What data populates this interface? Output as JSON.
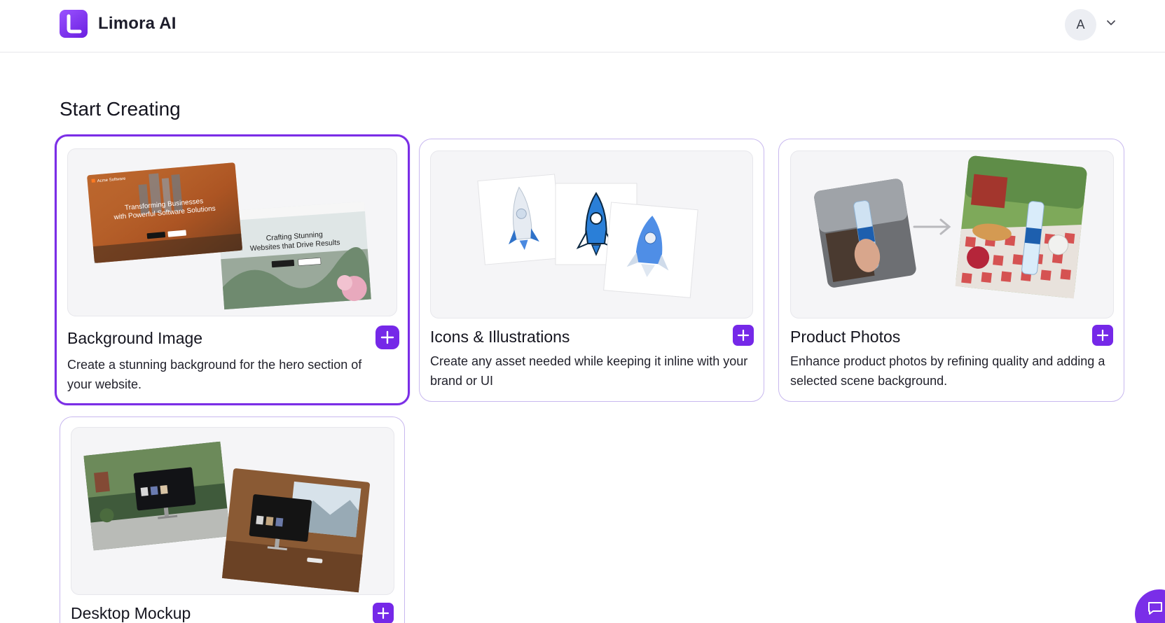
{
  "header": {
    "brand": "Limora AI",
    "avatar_initial": "A"
  },
  "page": {
    "title": "Start Creating"
  },
  "cards": [
    {
      "title": "Background Image",
      "description": "Create a stunning background for the hero section of your website.",
      "selected": true,
      "thumb_text": {
        "site_name": "Acme Software",
        "hero1": "Transforming Businesses with Powerful Software Solutions",
        "hero2": "Crafting Stunning Websites that Drive Results"
      }
    },
    {
      "title": "Icons & Illustrations",
      "description": "Create any asset needed while keeping it inline with your brand or UI",
      "selected": false
    },
    {
      "title": "Product Photos",
      "description": "Enhance product photos by refining quality and adding a selected scene background.",
      "selected": false
    },
    {
      "title": "Desktop Mockup",
      "description": "",
      "selected": false
    }
  ],
  "colors": {
    "accent": "#7528e8",
    "card_border": "#c8b8ef",
    "selected_border": "#7b2ee6"
  },
  "icons": {
    "logo": "limora-logo-icon",
    "chevron": "chevron-down-icon",
    "add": "plus-icon",
    "chat": "chat-icon"
  }
}
